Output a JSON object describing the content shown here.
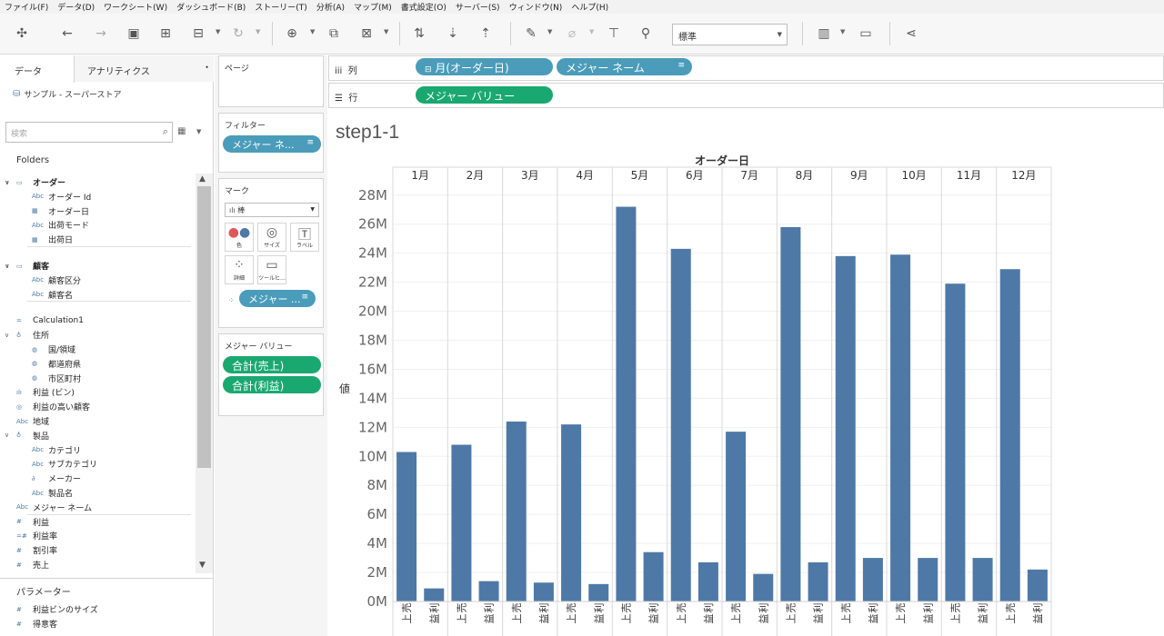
{
  "menu": [
    "ファイル(F)",
    "データ(D)",
    "ワークシート(W)",
    "ダッシュボード(B)",
    "ストーリー(T)",
    "分析(A)",
    "マップ(M)",
    "書式設定(O)",
    "サーバー(S)",
    "ウィンドウ(N)",
    "ヘルプ(H)"
  ],
  "toolbar": {
    "fit_value": "標準"
  },
  "data_pane": {
    "tab_data": "データ",
    "tab_analytics": "アナリティクス",
    "datasource": "サンプル - スーパーストア",
    "search_placeholder": "検索",
    "folders_title": "Folders",
    "parameters_title": "パラメーター",
    "fields": [
      {
        "label": "オーダー",
        "icon": "▭",
        "bold": true,
        "twist": "∨",
        "indent": 0
      },
      {
        "label": "オーダー Id",
        "icon": "Abc",
        "indent": 1
      },
      {
        "label": "オーダー日",
        "icon": "▦",
        "indent": 1
      },
      {
        "label": "出荷モード",
        "icon": "Abc",
        "indent": 1
      },
      {
        "label": "出荷日",
        "icon": "▦",
        "indent": 1,
        "divider": true
      },
      {
        "label": "顧客",
        "icon": "▭",
        "bold": true,
        "twist": "∨",
        "indent": 0,
        "gap": true
      },
      {
        "label": "顧客区分",
        "icon": "Abc",
        "indent": 1
      },
      {
        "label": "顧客名",
        "icon": "Abc",
        "indent": 1,
        "divider": true
      },
      {
        "label": "Calculation1",
        "icon": "=",
        "indent": 0,
        "gap": true
      },
      {
        "label": "住所",
        "icon": "♁",
        "twist": "∨",
        "indent": 0
      },
      {
        "label": "国/領域",
        "icon": "◍",
        "indent": 1
      },
      {
        "label": "都道府県",
        "icon": "◍",
        "indent": 1
      },
      {
        "label": "市区町村",
        "icon": "◍",
        "indent": 1
      },
      {
        "label": "利益 (ビン)",
        "icon": "ılı",
        "indent": 0
      },
      {
        "label": "利益の高い顧客",
        "icon": "◎",
        "indent": 0
      },
      {
        "label": "地域",
        "icon": "Abc",
        "indent": 0
      },
      {
        "label": "製品",
        "icon": "♁",
        "twist": "∨",
        "indent": 0
      },
      {
        "label": "カテゴリ",
        "icon": "Abc",
        "indent": 1
      },
      {
        "label": "サブカテゴリ",
        "icon": "Abc",
        "indent": 1
      },
      {
        "label": "メーカー",
        "icon": "∂",
        "indent": 1
      },
      {
        "label": "製品名",
        "icon": "Abc",
        "indent": 1
      },
      {
        "label": "メジャー ネーム",
        "icon": "Abc",
        "indent": 0,
        "divider": true
      },
      {
        "label": "利益",
        "icon": "#",
        "indent": 0
      },
      {
        "label": "利益率",
        "icon": "=#",
        "indent": 0
      },
      {
        "label": "割引率",
        "icon": "#",
        "indent": 0
      },
      {
        "label": "売上",
        "icon": "#",
        "indent": 0
      }
    ],
    "parameters": [
      {
        "label": "利益ビンのサイズ",
        "icon": "#"
      },
      {
        "label": "得意客",
        "icon": "#"
      }
    ]
  },
  "cards": {
    "pages_title": "ページ",
    "filters_title": "フィルター",
    "filter_pill": "メジャー ネ...",
    "marks_title": "マーク",
    "marks_type": "棒",
    "mark_buttons": [
      "色",
      "サイズ",
      "ラベル",
      "詳細",
      "ツールヒ..."
    ],
    "detail_pill": "メジャー ...",
    "measure_values_title": "メジャー バリュー",
    "measure_pills": [
      "合計(売上)",
      "合計(利益)"
    ]
  },
  "shelves": {
    "columns_label": "列",
    "rows_label": "行",
    "column_pills": [
      "月(オーダー日)",
      "メジャー ネーム"
    ],
    "row_pills": [
      "メジャー バリュー"
    ]
  },
  "sheet_title": "step1-1",
  "colors": {
    "bar": "#4e79a7",
    "pill_blue": "#4a9cba",
    "pill_green": "#1aa871"
  },
  "chart_data": {
    "type": "bar",
    "header_title": "オーダー日",
    "ylabel": "値",
    "months": [
      "1月",
      "2月",
      "3月",
      "4月",
      "5月",
      "6月",
      "7月",
      "8月",
      "9月",
      "10月",
      "11月",
      "12月"
    ],
    "measures": [
      "売上",
      "利益"
    ],
    "series": [
      {
        "name": "売上",
        "values": [
          10.3,
          10.8,
          12.4,
          12.2,
          27.2,
          24.3,
          11.7,
          25.8,
          23.8,
          23.9,
          21.9,
          22.9
        ]
      },
      {
        "name": "利益",
        "values": [
          0.9,
          1.4,
          1.3,
          1.2,
          3.4,
          2.7,
          1.9,
          2.7,
          3.0,
          3.0,
          3.0,
          2.2
        ]
      }
    ],
    "yticks": [
      0,
      2,
      4,
      6,
      8,
      10,
      12,
      14,
      16,
      18,
      20,
      22,
      24,
      26,
      28
    ],
    "ytick_suffix": "M",
    "ylim": [
      0,
      28.8
    ]
  }
}
